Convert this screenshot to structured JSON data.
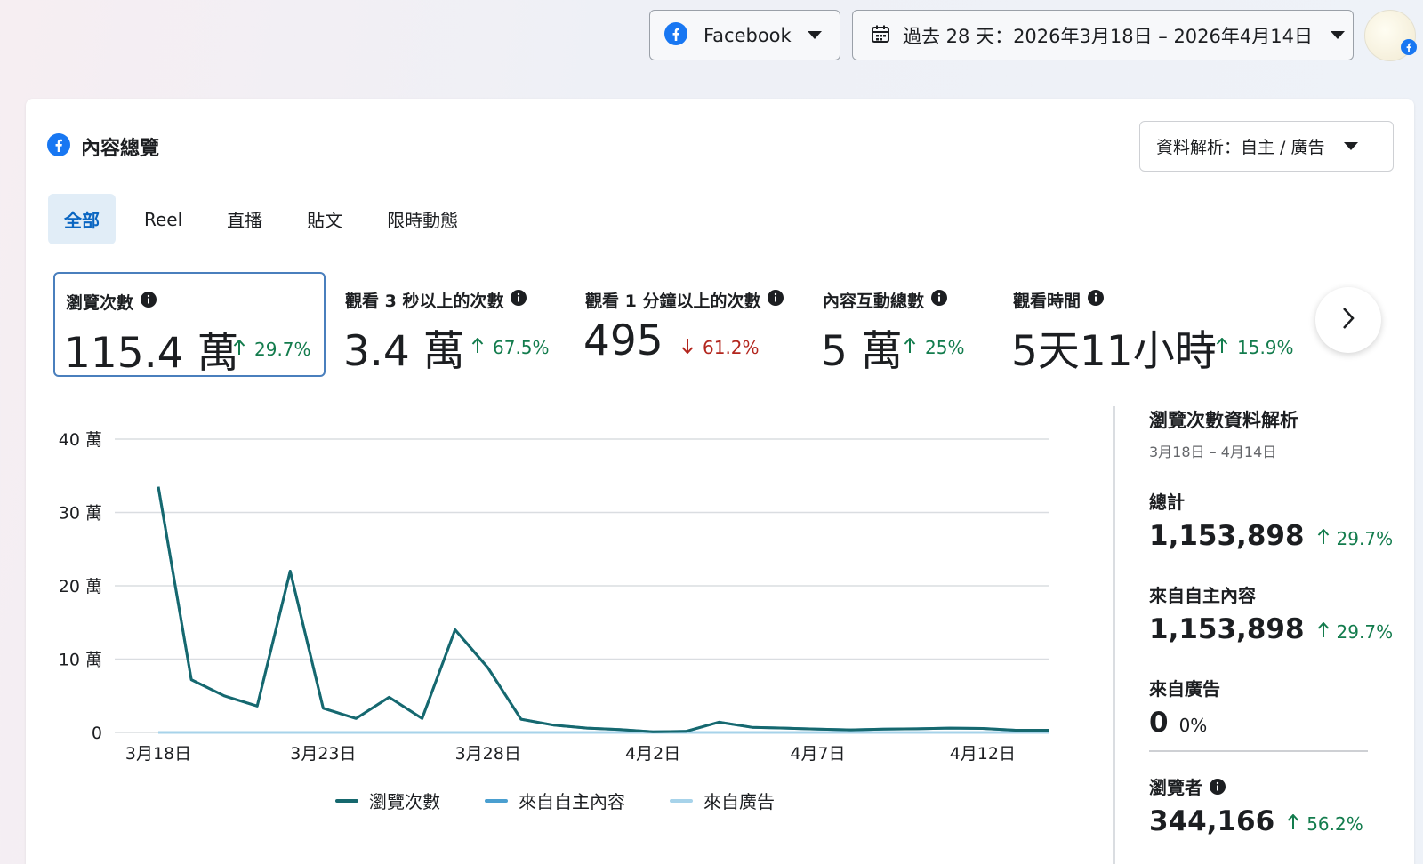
{
  "header": {
    "platform_label": "Facebook",
    "date_range_label": "過去 28 天：2026年3月18日 – 2026年4月14日"
  },
  "card": {
    "title": "內容總覽",
    "breakdown_label": "資料解析：自主 / 廣告"
  },
  "tabs": [
    {
      "label": "全部",
      "active": true
    },
    {
      "label": "Reel",
      "active": false
    },
    {
      "label": "直播",
      "active": false
    },
    {
      "label": "貼文",
      "active": false
    },
    {
      "label": "限時動態",
      "active": false
    }
  ],
  "metrics": [
    {
      "label": "瀏覽次數",
      "value": "115.4 萬",
      "change": "29.7%",
      "direction": "up",
      "selected": true
    },
    {
      "label": "觀看 3 秒以上的次數",
      "value": "3.4 萬",
      "change": "67.5%",
      "direction": "up",
      "selected": false
    },
    {
      "label": "觀看 1 分鐘以上的次數",
      "value": "495",
      "change": "61.2%",
      "direction": "down",
      "selected": false
    },
    {
      "label": "內容互動總數",
      "value": "5 萬",
      "change": "25%",
      "direction": "up",
      "selected": false
    },
    {
      "label": "觀看時間",
      "value": "5天11小時",
      "change": "15.9%",
      "direction": "up",
      "selected": false
    }
  ],
  "side_panel": {
    "title": "瀏覽次數資料解析",
    "subtitle": "3月18日 – 4月14日",
    "total_label": "總計",
    "total_value": "1,153,898",
    "total_change": "29.7%",
    "organic_label": "來自自主內容",
    "organic_value": "1,153,898",
    "organic_change": "29.7%",
    "ads_label": "來自廣告",
    "ads_value": "0",
    "ads_change": "0%",
    "viewers_label": "瀏覽者",
    "viewers_value": "344,166",
    "viewers_change": "56.2%"
  },
  "colors": {
    "accent": "#0a66c2",
    "series_views": "#16686e",
    "series_organic": "#4a9fd0",
    "series_ads": "#a7d3ea",
    "up": "#137c4d",
    "down": "#b3261e"
  },
  "chart_data": {
    "type": "line",
    "x": [
      "3月18日",
      "3月19日",
      "3月20日",
      "3月21日",
      "3月22日",
      "3月23日",
      "3月24日",
      "3月25日",
      "3月26日",
      "3月27日",
      "3月28日",
      "3月29日",
      "3月30日",
      "3月31日",
      "4月1日",
      "4月2日",
      "4月3日",
      "4月4日",
      "4月5日",
      "4月6日",
      "4月7日",
      "4月8日",
      "4月9日",
      "4月10日",
      "4月11日",
      "4月12日",
      "4月13日",
      "4月14日"
    ],
    "x_tick_labels": [
      "3月18日",
      "3月23日",
      "3月28日",
      "4月2日",
      "4月7日",
      "4月12日"
    ],
    "y_tick_labels": [
      "0",
      "10 萬",
      "20 萬",
      "30 萬",
      "40 萬"
    ],
    "ylim": [
      0,
      400000
    ],
    "y_ticks": [
      0,
      100000,
      200000,
      300000,
      400000
    ],
    "grid": true,
    "legend_position": "bottom",
    "series": [
      {
        "name": "瀏覽次數",
        "values": [
          335000,
          72000,
          50000,
          36000,
          220000,
          33000,
          19000,
          48000,
          19000,
          140000,
          88000,
          18000,
          10000,
          6000,
          4000,
          1000,
          1500,
          14000,
          7000,
          6000,
          4500,
          3500,
          4500,
          5000,
          6000,
          5500,
          3000,
          3000
        ]
      },
      {
        "name": "來自自主內容",
        "values": [
          335000,
          72000,
          50000,
          36000,
          220000,
          33000,
          19000,
          48000,
          19000,
          140000,
          88000,
          18000,
          10000,
          6000,
          4000,
          1000,
          1500,
          14000,
          7000,
          6000,
          4500,
          3500,
          4500,
          5000,
          6000,
          5500,
          3000,
          3000
        ]
      },
      {
        "name": "來自廣告",
        "values": [
          0,
          0,
          0,
          0,
          0,
          0,
          0,
          0,
          0,
          0,
          0,
          0,
          0,
          0,
          0,
          0,
          0,
          0,
          0,
          0,
          0,
          0,
          0,
          0,
          0,
          0,
          0,
          0
        ]
      }
    ]
  }
}
